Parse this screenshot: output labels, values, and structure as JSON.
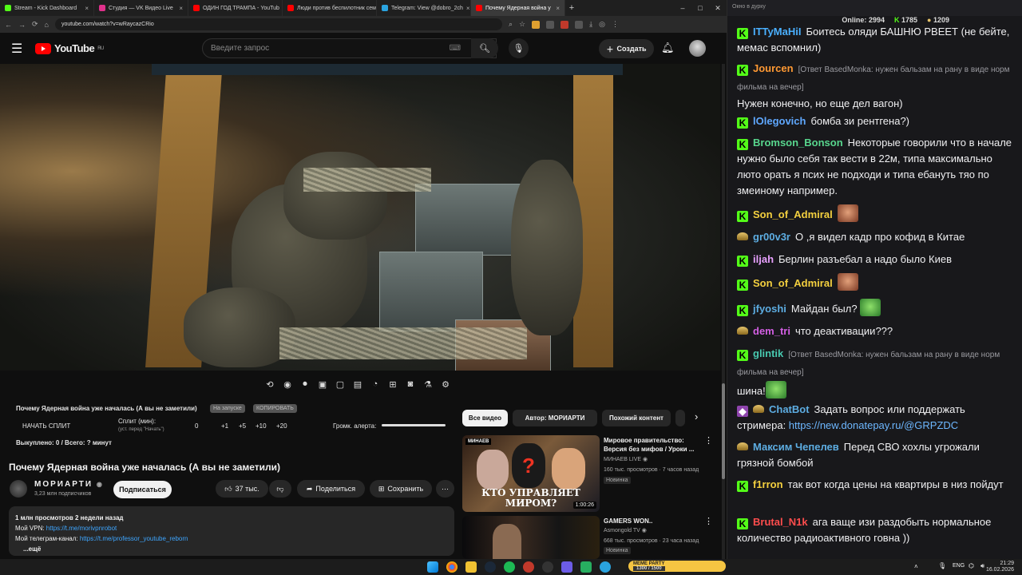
{
  "browser": {
    "tabs": [
      {
        "title": "Stream - Kick Dashboard",
        "color": "#53fc18",
        "active": false
      },
      {
        "title": "Студия — VK Видео Live",
        "color": "#e0318c",
        "active": false
      },
      {
        "title": "ОДИН ГОД ТРАМПА - YouTub",
        "color": "#ff0000",
        "active": false
      },
      {
        "title": "Люди против беспилотник сем",
        "color": "#ff0000",
        "active": false
      },
      {
        "title": "Telegram: View @dobro_2ch",
        "color": "#2aa3df",
        "active": false
      },
      {
        "title": "Почему Ядерная война у",
        "color": "#ff0000",
        "active": true
      }
    ],
    "url": "youtube.com/watch?v=wRaycazCRio"
  },
  "youtube": {
    "logo_text": "YouTube",
    "logo_region": "RU",
    "search_placeholder": "Введите запрос",
    "create_label": "Создать",
    "controls": [
      "⟲",
      "◉",
      "⏺",
      "▣",
      "▢",
      "▤",
      "◔",
      "⊞",
      "◙",
      "⚗",
      "⚙"
    ]
  },
  "split": {
    "title": "Почему Ядерная война уже началась (А вы не заметили)",
    "tag1": "На запуске",
    "tag2": "КОПИРОВАТЬ",
    "start_label": "НАЧАТЬ СПЛИТ",
    "minutes_label": "Сплит (мин):",
    "minutes_hint": "(уст. перед \"Начать\")",
    "minutes_value": "0",
    "inc1": "+1",
    "inc5": "+5",
    "inc10": "+10",
    "inc20": "+20",
    "volume_label": "Громк. алерта:",
    "bought_label": "Выкуплено: 0 / Всего: ? минут"
  },
  "video": {
    "title": "Почему Ядерная война уже началась (А вы не заметили)",
    "channel": "МОРИАРТИ",
    "subscribers": "3,23 млн подписчиков",
    "subscribe_label": "Подписаться",
    "likes": "37 тыс.",
    "share_label": "Поделиться",
    "save_label": "Сохранить",
    "description": {
      "stats": "1 млн просмотров  2 недели назад",
      "vpn_label": "Мой VPN: ",
      "vpn_link": "https://t.me/morivpnrobot",
      "tg_label": "Мой телеграм-канал: ",
      "tg_link": "https://t.me/professor_youtube_reborn",
      "more": "...ещё"
    }
  },
  "related": {
    "chips": [
      "Все видео",
      "Автор: МОРИАРТИ",
      "Похожий контент"
    ],
    "videos": [
      {
        "title": "Мировое правительство: Версия без мифов / Уроки ...",
        "channel": "МИНАЕВ LIVE",
        "meta": "160 тыс. просмотров · 7 часов назад",
        "badge": "Новинка",
        "duration": "1:00:26",
        "thumb_text": "КТО УПРАВЛЯЕТ МИРОМ?",
        "thumb_brand": "МИНАЕВ"
      },
      {
        "title": "GAMERS WON..",
        "channel": "Asmongold TV",
        "meta": "668 тыс. просмотров · 23 часа назад",
        "badge": "Новинка",
        "duration": "",
        "thumb_text": "",
        "thumb_brand": ""
      }
    ]
  },
  "chat": {
    "header": "Окно в дуркy",
    "online_label": "Online:",
    "online": "2994",
    "kick_count": "1785",
    "other_count": "1209",
    "messages": [
      {
        "badge": "kick",
        "user": "ITTyMaHiI",
        "color": "#4ab0ff",
        "reply": "",
        "text": "Боитесь оляди БАШНЮ РВЕЕТ (не бейте, мемас вспомнил)",
        "emote": ""
      },
      {
        "badge": "kick",
        "user": "Jourcen",
        "color": "#ff9933",
        "reply": "[Ответ BasedMonka: нужен бальзам на рану в виде норм фильма на вечер]",
        "text": "Нужен конечно, но еще дел вагон)",
        "emote": ""
      },
      {
        "badge": "kick",
        "user": "lOlegovich",
        "color": "#5fa8ff",
        "reply": "",
        "text": "бомба зи рентгена?)",
        "emote": ""
      },
      {
        "badge": "kick",
        "user": "Bromson_Bonson",
        "color": "#58d68d",
        "reply": "",
        "text": "Некоторые говорили что в начале нужно было себя так вести в 22м, типа максимально люто орать я псих не подходи и типа ебануть тяо по змеиному например.",
        "emote": ""
      },
      {
        "badge": "kick",
        "user": "Son_of_Admiral",
        "color": "#f4d03f",
        "reply": "",
        "text": "",
        "emote": "face"
      },
      {
        "badge": "bag",
        "user": "gr00v3r",
        "color": "#5dade2",
        "reply": "",
        "text": "О ,я видел кадр про кофид в Китае",
        "emote": ""
      },
      {
        "badge": "kick",
        "user": "iljah",
        "color": "#e8a0ff",
        "reply": "",
        "text": "Берлин разъебал а надо было Киев",
        "emote": ""
      },
      {
        "badge": "kick",
        "user": "Son_of_Admiral",
        "color": "#f4d03f",
        "reply": "",
        "text": "",
        "emote": "face"
      },
      {
        "badge": "kick",
        "user": "jfyoshi",
        "color": "#5dade2",
        "reply": "",
        "text": "Майдан был?",
        "emote": "frog"
      },
      {
        "badge": "bag",
        "user": "dem_tri",
        "color": "#d35fe3",
        "reply": "",
        "text": "что деактивации???",
        "emote": ""
      },
      {
        "badge": "kick",
        "user": "glintik",
        "color": "#48c9b0",
        "reply": "[Ответ BasedMonka: нужен бальзам на рану в виде норм фильма на вечер]",
        "text": "шина!",
        "emote": "frog"
      },
      {
        "badge": "bot",
        "user": "ChatBot",
        "color": "#5dade2",
        "reply": "",
        "text": "Задать вопрос или поддержать стримера: ",
        "link": "https://new.donatepay.ru/@GRPZDC",
        "emote": ""
      },
      {
        "badge": "bag",
        "user": "Максим Чепелев",
        "color": "#5dade2",
        "reply": "",
        "text": "Перед СВО хохлы угрожали грязной бомбой",
        "emote": ""
      },
      {
        "badge": "kick",
        "user": "f1rron",
        "color": "#f4d03f",
        "reply": "",
        "text": "так вот когда цены на квартиры в низ пойдут",
        "emote": ""
      },
      {
        "badge": "kick",
        "user": "Brutal_N1k",
        "color": "#ff4d4d",
        "reply": "",
        "text": "ага ваще изи раздобыть нормальное количество радиоактивного говна ))",
        "emote": ""
      }
    ]
  },
  "taskbar": {
    "meme_widget": "MEME PARTY",
    "meme_value": "1300 / 1500",
    "lang": "ENG",
    "time": "21:29",
    "date": "16.02.2026"
  }
}
